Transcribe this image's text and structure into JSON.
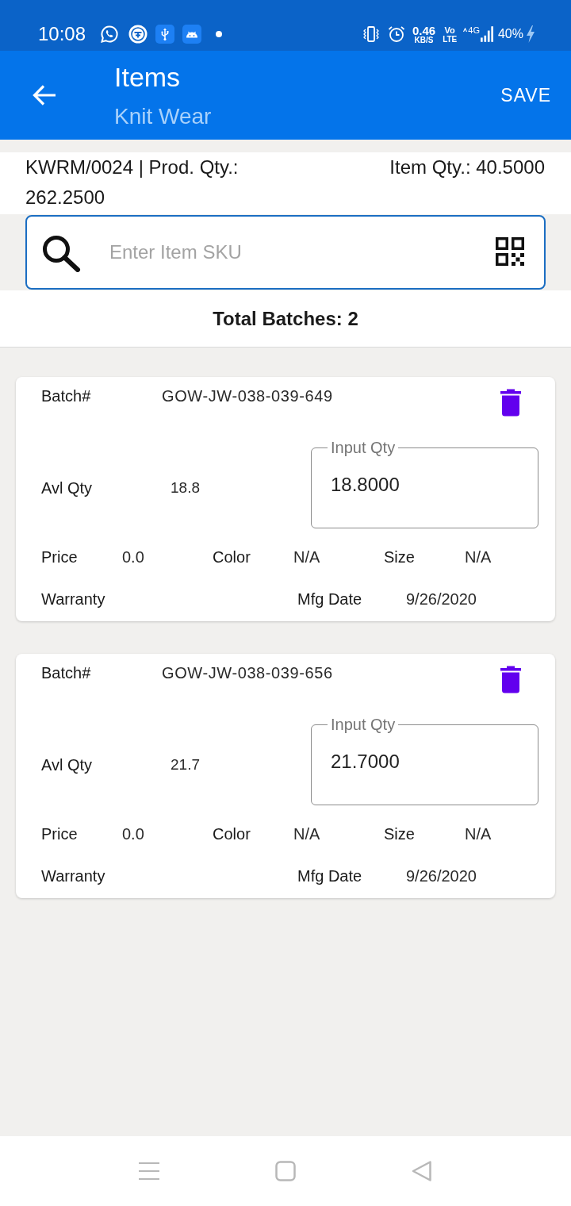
{
  "status_bar": {
    "time": "10:08",
    "speed": "0.46",
    "speed_unit": "KB/S",
    "volte_top": "Vo",
    "volte_bottom": "LTE",
    "network": "4G",
    "battery": "40%"
  },
  "app_bar": {
    "title": "Items",
    "subtitle": "Knit Wear",
    "action": "SAVE"
  },
  "summary": {
    "production": "KWRM/0024 | Prod. Qty.: 262.2500",
    "item_qty": "Item Qty.: 40.5000"
  },
  "search": {
    "placeholder": "Enter Item SKU"
  },
  "total_batches": "Total Batches: 2",
  "batches": [
    {
      "batch_label": "Batch#",
      "batch_no": "GOW-JW-038-039-649",
      "avl_qty_label": "Avl Qty",
      "avl_qty": "18.8",
      "input_label": "Input Qty",
      "input_value": "18.8000",
      "price_label": "Price",
      "price": "0.0",
      "color_label": "Color",
      "color_value": "N/A",
      "size_label": "Size",
      "size": "N/A",
      "warranty_label": "Warranty",
      "mfg_date_label": "Mfg Date",
      "mfg_date": "9/26/2020"
    },
    {
      "batch_label": "Batch#",
      "batch_no": "GOW-JW-038-039-656",
      "avl_qty_label": "Avl Qty",
      "avl_qty": "21.7",
      "input_label": "Input Qty",
      "input_value": "21.7000",
      "price_label": "Price",
      "price": "0.0",
      "color_label": "Color",
      "color_value": "N/A",
      "size_label": "Size",
      "size": "N/A",
      "warranty_label": "Warranty",
      "mfg_date_label": "Mfg Date",
      "mfg_date": "9/26/2020"
    }
  ]
}
